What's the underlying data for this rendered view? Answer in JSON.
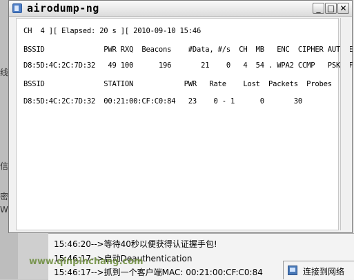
{
  "window": {
    "title": "airodump-ng",
    "min_label": "_",
    "max_label": "□",
    "close_label": "✕"
  },
  "terminal": {
    "status_line": "CH  4 ][ Elapsed: 20 s ][ 2010-09-10 15:46",
    "ap_header": "BSSID              PWR RXQ  Beacons    #Data, #/s  CH  MB   ENC  CIPHER AUTH E",
    "ap_row": "D8:5D:4C:2C:7D:32   49 100      196       21    0   4  54 . WPA2 CCMP   PSK  F",
    "station_header": "BSSID              STATION            PWR   Rate    Lost  Packets  Probes",
    "station_row": "D8:5D:4C:2C:7D:32  00:21:00:CF:C0:84   23    0 - 1      0       30"
  },
  "background": {
    "left_labels": [
      "线",
      "信",
      "密",
      "W"
    ]
  },
  "log": {
    "lines": [
      "15:46:20-->等待40秒以便获得认证握手包!",
      "15:46:17-->启动Deauthentication",
      "15:46:17-->抓到一个客户端MAC: 00:21:00:CF:C0:84"
    ]
  },
  "watermark": "www.qinpinchang.com",
  "tray": {
    "status": "连接到网络",
    "icon": "network-icon"
  }
}
